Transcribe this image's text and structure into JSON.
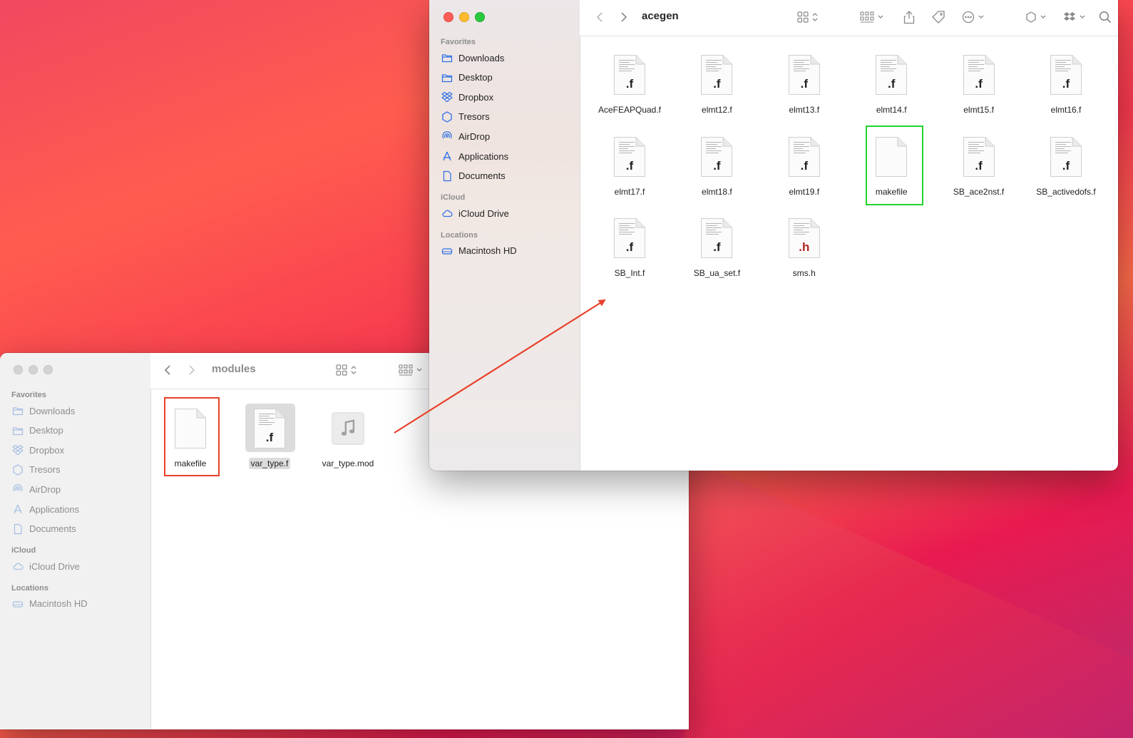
{
  "colors": {
    "annotation_red": "#e8412b",
    "annotation_green": "#22d32c",
    "sidebar_accent": "#2d6fe5"
  },
  "back_window": {
    "title": "modules",
    "sidebar": {
      "sections": [
        {
          "heading": "Favorites",
          "items": [
            {
              "label": "Downloads",
              "icon": "folder-icon"
            },
            {
              "label": "Desktop",
              "icon": "folder-icon"
            },
            {
              "label": "Dropbox",
              "icon": "dropbox-icon"
            },
            {
              "label": "Tresors",
              "icon": "hexagon-icon"
            },
            {
              "label": "AirDrop",
              "icon": "airdrop-icon"
            },
            {
              "label": "Applications",
              "icon": "applications-icon"
            },
            {
              "label": "Documents",
              "icon": "document-icon"
            }
          ]
        },
        {
          "heading": "iCloud",
          "items": [
            {
              "label": "iCloud Drive",
              "icon": "cloud-icon"
            }
          ]
        },
        {
          "heading": "Locations",
          "items": [
            {
              "label": "Macintosh HD",
              "icon": "disk-icon"
            }
          ]
        }
      ]
    },
    "files": [
      {
        "name": "makefile",
        "ext": "",
        "kind": "blank"
      },
      {
        "name": "var_type.f",
        "ext": ".f",
        "kind": "source"
      },
      {
        "name": "var_type.mod",
        "ext": "",
        "kind": "music"
      }
    ]
  },
  "front_window": {
    "title": "acegen",
    "sidebar": {
      "sections": [
        {
          "heading": "Favorites",
          "items": [
            {
              "label": "Downloads",
              "icon": "folder-icon"
            },
            {
              "label": "Desktop",
              "icon": "folder-icon"
            },
            {
              "label": "Dropbox",
              "icon": "dropbox-icon"
            },
            {
              "label": "Tresors",
              "icon": "hexagon-icon"
            },
            {
              "label": "AirDrop",
              "icon": "airdrop-icon"
            },
            {
              "label": "Applications",
              "icon": "applications-icon"
            },
            {
              "label": "Documents",
              "icon": "document-icon"
            }
          ]
        },
        {
          "heading": "iCloud",
          "items": [
            {
              "label": "iCloud Drive",
              "icon": "cloud-icon"
            }
          ]
        },
        {
          "heading": "Locations",
          "items": [
            {
              "label": "Macintosh HD",
              "icon": "disk-icon"
            }
          ]
        }
      ]
    },
    "files": [
      {
        "name": "AceFEAPQuad.f",
        "ext": ".f"
      },
      {
        "name": "elmt12.f",
        "ext": ".f"
      },
      {
        "name": "elmt13.f",
        "ext": ".f"
      },
      {
        "name": "elmt14.f",
        "ext": ".f"
      },
      {
        "name": "elmt15.f",
        "ext": ".f"
      },
      {
        "name": "elmt16.f",
        "ext": ".f"
      },
      {
        "name": "elmt17.f",
        "ext": ".f"
      },
      {
        "name": "elmt18.f",
        "ext": ".f"
      },
      {
        "name": "elmt19.f",
        "ext": ".f"
      },
      {
        "name": "makefile",
        "ext": ""
      },
      {
        "name": "SB_ace2nst.f",
        "ext": ".f"
      },
      {
        "name": "SB_activedofs.f",
        "ext": ".f"
      },
      {
        "name": "SB_Int.f",
        "ext": ".f"
      },
      {
        "name": "SB_ua_set.f",
        "ext": ".f"
      },
      {
        "name": "sms.h",
        "ext": ".h"
      }
    ]
  }
}
